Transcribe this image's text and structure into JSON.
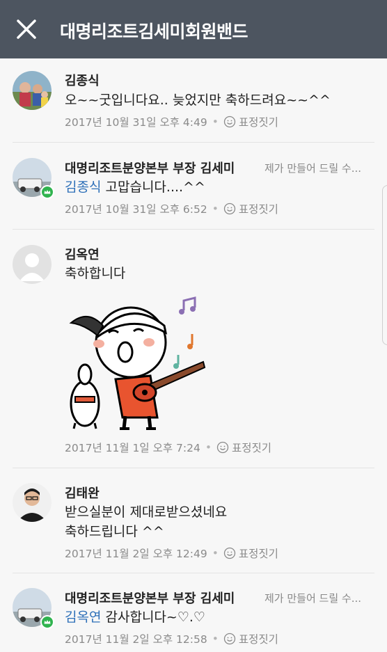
{
  "header": {
    "title": "대명리조트김세미회원밴드",
    "close_icon": "close-icon"
  },
  "comments": [
    {
      "author": "김종식",
      "mention": "",
      "text": "오~~굿입니다요.. 늦었지만 축하드려요~~^^",
      "time": "2017년 10월 31일 오후 4:49",
      "react": "표정짓기"
    },
    {
      "author": "대명리조트분양본부 부장 김세미",
      "preview": "제가 만들어 드릴 수...",
      "mention": "김종식",
      "text": "고맙습니다....^^",
      "time": "2017년 10월 31일 오후 6:52",
      "react": "표정짓기"
    },
    {
      "author": "김옥연",
      "mention": "",
      "text": "축하합니다",
      "sticker": "guitar-boy-sticker",
      "time": "2017년 11월 1일 오후 7:24",
      "react": "표정짓기"
    },
    {
      "author": "김태완",
      "mention": "",
      "text_lines": [
        "받으실분이 제대로받으셨네요",
        "축하드립니다 ^^"
      ],
      "time": "2017년 11월 2일 오후 12:49",
      "react": "표정짓기"
    },
    {
      "author": "대명리조트분양본부 부장 김세미",
      "preview": "제가 만들어 드릴 수...",
      "mention": "김옥연",
      "text": "감사합니다~♡.♡",
      "time": "2017년 11월 2일 오후 12:58",
      "react": "표정짓기"
    }
  ],
  "colors": {
    "header_bg": "#4d5560",
    "mention": "#2d6fb8",
    "badge": "#30b34f"
  }
}
